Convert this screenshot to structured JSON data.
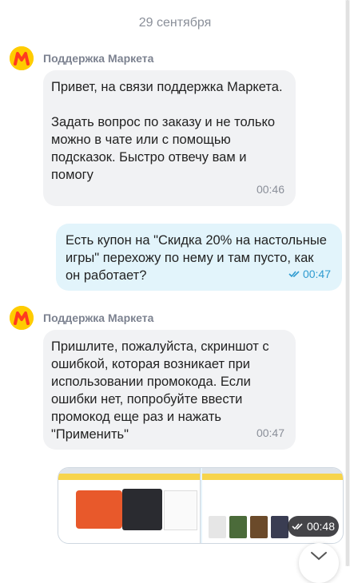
{
  "date_separator": "29 сентября",
  "messages": [
    {
      "sender": "Поддержка Маркета",
      "text": "Привет, на связи поддержка Маркета.\n\nЗадать вопрос по заказу и не только можно в чате или с помощью подсказок. Быстро отвечу вам и помогу",
      "time": "00:46"
    },
    {
      "text": "Есть купон на \"Скидка 20% на настольные игры\" перехожу по нему и там пусто, как он работает?",
      "time": "00:47"
    },
    {
      "sender": "Поддержка Маркета",
      "text": "Пришлите, пожалуйста, скриншот с ошибкой, которая возникает при использовании промокода. Если ошибки нет, попробуйте ввести промокод еще раз и нажать \"Применить\"",
      "time": "00:47"
    },
    {
      "type": "image",
      "time": "00:48"
    }
  ],
  "colors": {
    "brand_yellow": "#ffcc00",
    "brand_red": "#ff3b1f",
    "incoming_bubble": "#f1f2f4",
    "outgoing_bubble": "#e2f4fb",
    "read_check": "#2e9bd0"
  },
  "icons": {
    "avatar": "yandex-market-logo",
    "read_status": "double-check-icon",
    "scroll_down": "chevron-down-icon"
  }
}
